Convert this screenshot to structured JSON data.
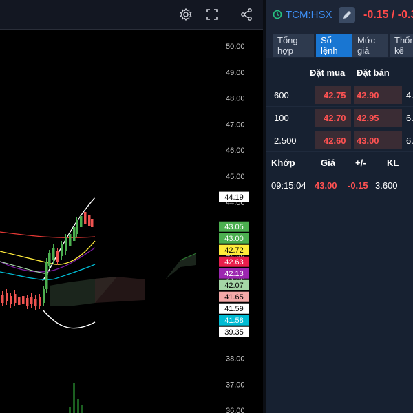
{
  "toolbar": {
    "settings_icon": "gear-icon",
    "fullscreen_icon": "fullscreen-icon",
    "share_icon": "share-icon"
  },
  "axis": {
    "ticks": [
      "50.00",
      "49.00",
      "48.00",
      "47.00",
      "46.00",
      "45.00",
      "44.00",
      "43.00",
      "42.00",
      "41.00",
      "40.00",
      "39.00",
      "38.00",
      "37.00",
      "36.00"
    ]
  },
  "tags": [
    {
      "label": "44.19",
      "bg": "#ffffff",
      "fg": "#000000"
    },
    {
      "label": "43.05",
      "bg": "#4caf50",
      "fg": "#ffffff"
    },
    {
      "label": "43.00",
      "bg": "#4caf50",
      "fg": "#ffffff"
    },
    {
      "label": "42.72",
      "bg": "#ffeb3b",
      "fg": "#000000"
    },
    {
      "label": "42.63",
      "bg": "#e91e4c",
      "fg": "#ffffff"
    },
    {
      "label": "42.13",
      "bg": "#9c27b0",
      "fg": "#ffffff"
    },
    {
      "label": "42.07",
      "bg": "#a5d6a7",
      "fg": "#000000"
    },
    {
      "label": "41.65",
      "bg": "#f4a8a8",
      "fg": "#000000"
    },
    {
      "label": "41.59",
      "bg": "#ffffff",
      "fg": "#000000"
    },
    {
      "label": "41.58",
      "bg": "#00bcd4",
      "fg": "#ffffff"
    },
    {
      "label": "39.35",
      "bg": "#ffffff",
      "fg": "#000000"
    }
  ],
  "colors": {
    "up": "#4caf50",
    "down": "#ef5350",
    "accent": "#1976d2",
    "price_red": "#ff5252"
  },
  "stock": {
    "symbol": "TCM:HSX",
    "change": "-0.15 / -0.3"
  },
  "tabs": [
    {
      "label_1": "Tổng",
      "label_2": "hợp"
    },
    {
      "label_1": "Sổ",
      "label_2": "lệnh"
    },
    {
      "label_1": "Mức",
      "label_2": "giá"
    },
    {
      "label_1": "Thốn",
      "label_2": "kê"
    }
  ],
  "orderbook": {
    "bid_header": "Đặt mua",
    "ask_header": "Đặt bán",
    "rows": [
      {
        "bid_vol": "600",
        "bid": "42.75",
        "ask": "42.90",
        "ask_vol": "4."
      },
      {
        "bid_vol": "100",
        "bid": "42.70",
        "ask": "42.95",
        "ask_vol": "6."
      },
      {
        "bid_vol": "2.500",
        "bid": "42.60",
        "ask": "43.00",
        "ask_vol": "6."
      }
    ]
  },
  "matched": {
    "headers": {
      "time": "Khớp",
      "price": "Giá",
      "change": "+/-",
      "volume": "KL"
    },
    "rows": [
      {
        "time": "09:15:04",
        "price": "43.00",
        "change": "-0.15",
        "volume": "3.600"
      }
    ]
  }
}
